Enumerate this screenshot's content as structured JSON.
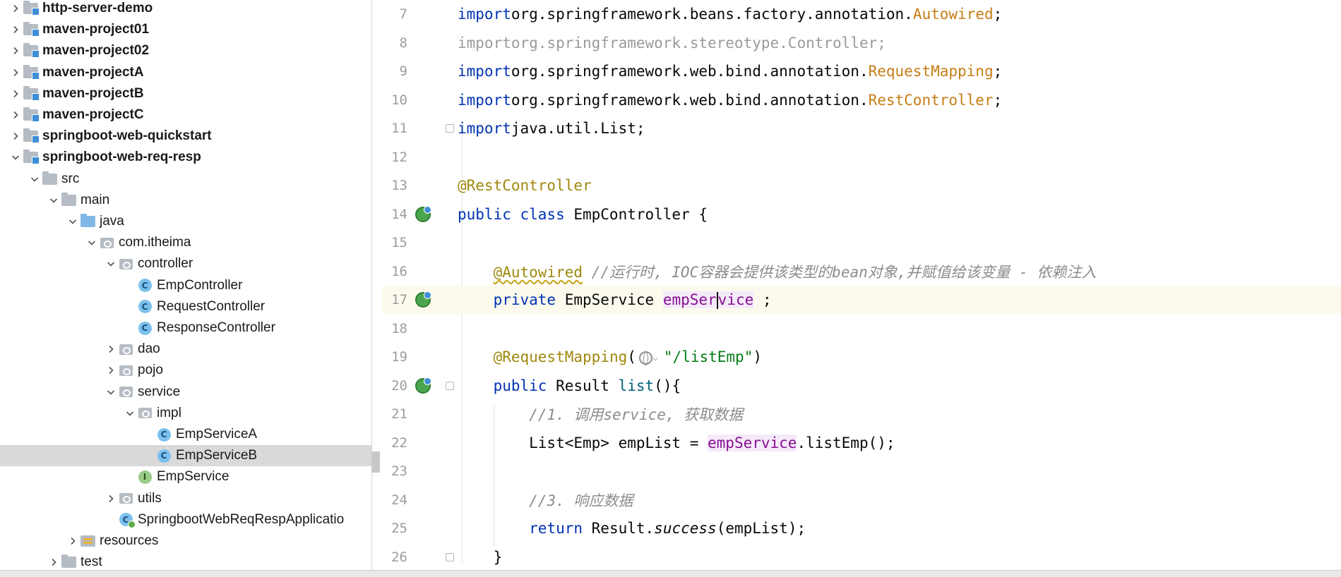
{
  "project_tree": {
    "items": [
      {
        "label": "http-server-demo",
        "depth": 0,
        "kind": "module",
        "expanded": false,
        "bold": true
      },
      {
        "label": "maven-project01",
        "depth": 0,
        "kind": "module",
        "expanded": false,
        "bold": true
      },
      {
        "label": "maven-project02",
        "depth": 0,
        "kind": "module",
        "expanded": false,
        "bold": true
      },
      {
        "label": "maven-projectA",
        "depth": 0,
        "kind": "module",
        "expanded": false,
        "bold": true
      },
      {
        "label": "maven-projectB",
        "depth": 0,
        "kind": "module",
        "expanded": false,
        "bold": true
      },
      {
        "label": "maven-projectC",
        "depth": 0,
        "kind": "module",
        "expanded": false,
        "bold": true
      },
      {
        "label": "springboot-web-quickstart",
        "depth": 0,
        "kind": "module",
        "expanded": false,
        "bold": true
      },
      {
        "label": "springboot-web-req-resp",
        "depth": 0,
        "kind": "module",
        "expanded": true,
        "bold": true
      },
      {
        "label": "src",
        "depth": 1,
        "kind": "folder",
        "expanded": true
      },
      {
        "label": "main",
        "depth": 2,
        "kind": "folder",
        "expanded": true
      },
      {
        "label": "java",
        "depth": 3,
        "kind": "source-folder",
        "expanded": true
      },
      {
        "label": "com.itheima",
        "depth": 4,
        "kind": "package",
        "expanded": true
      },
      {
        "label": "controller",
        "depth": 5,
        "kind": "package",
        "expanded": true
      },
      {
        "label": "EmpController",
        "depth": 6,
        "kind": "class"
      },
      {
        "label": "RequestController",
        "depth": 6,
        "kind": "class"
      },
      {
        "label": "ResponseController",
        "depth": 6,
        "kind": "class"
      },
      {
        "label": "dao",
        "depth": 5,
        "kind": "package",
        "expanded": false
      },
      {
        "label": "pojo",
        "depth": 5,
        "kind": "package",
        "expanded": false
      },
      {
        "label": "service",
        "depth": 5,
        "kind": "package",
        "expanded": true
      },
      {
        "label": "impl",
        "depth": 6,
        "kind": "package",
        "expanded": true
      },
      {
        "label": "EmpServiceA",
        "depth": 7,
        "kind": "class"
      },
      {
        "label": "EmpServiceB",
        "depth": 7,
        "kind": "class",
        "selected": true
      },
      {
        "label": "EmpService",
        "depth": 6,
        "kind": "interface"
      },
      {
        "label": "utils",
        "depth": 5,
        "kind": "package",
        "expanded": false
      },
      {
        "label": "SpringbootWebReqRespApplicatio",
        "depth": 5,
        "kind": "app-class"
      },
      {
        "label": "resources",
        "depth": 3,
        "kind": "resources-folder",
        "expanded": false
      },
      {
        "label": "test",
        "depth": 2,
        "kind": "folder",
        "expanded": false
      }
    ]
  },
  "editor": {
    "lines": [
      {
        "n": "7",
        "tokens": [
          [
            "kw",
            "import"
          ],
          [
            "",
            "org.springframework.beans.factory.annotation."
          ],
          [
            "cls-ref",
            "Autowired"
          ],
          [
            "",
            ";"
          ]
        ]
      },
      {
        "n": "8",
        "faded": true,
        "tokens": [
          [
            "kw",
            "import"
          ],
          [
            "",
            "org.springframework.stereotype.Controller;"
          ]
        ]
      },
      {
        "n": "9",
        "tokens": [
          [
            "kw",
            "import"
          ],
          [
            "",
            "org.springframework.web.bind.annotation."
          ],
          [
            "cls-ref",
            "RequestMapping"
          ],
          [
            "",
            ";"
          ]
        ]
      },
      {
        "n": "10",
        "tokens": [
          [
            "kw",
            "import"
          ],
          [
            "",
            "org.springframework.web.bind.annotation."
          ],
          [
            "cls-ref",
            "RestController"
          ],
          [
            "",
            ";"
          ]
        ]
      },
      {
        "n": "11",
        "fold": true,
        "tokens": [
          [
            "kw",
            "import"
          ],
          [
            "",
            "java.util.List;"
          ]
        ]
      },
      {
        "n": "12",
        "tokens": []
      },
      {
        "n": "13",
        "tokens": [
          [
            "ann",
            "@RestController"
          ]
        ]
      },
      {
        "n": "14",
        "gutter_icon": "spring-bean-icon",
        "tokens": [
          [
            "kw",
            "public class"
          ],
          [
            "",
            " EmpController {"
          ]
        ]
      },
      {
        "n": "15",
        "tokens": []
      },
      {
        "n": "16",
        "tokens": [
          [
            "",
            "    "
          ],
          [
            "ann squig",
            "@Autowired"
          ],
          [
            "",
            " "
          ],
          [
            "cmt",
            "//运行时, IOC容器会提供该类型的bean对象,并赋值给该变量 - 依赖注入"
          ]
        ]
      },
      {
        "n": "17",
        "current": true,
        "gutter_icon": "spring-bean-icon",
        "tokens": [
          [
            "",
            "    "
          ],
          [
            "kw",
            "private"
          ],
          [
            "",
            " EmpService "
          ],
          [
            "field",
            "empSer"
          ],
          [
            "caret",
            ""
          ],
          [
            "field",
            "vice"
          ],
          [
            "",
            " ;"
          ]
        ]
      },
      {
        "n": "18",
        "tokens": []
      },
      {
        "n": "19",
        "tokens": [
          [
            "",
            "    "
          ],
          [
            "ann",
            "@RequestMapping"
          ],
          [
            "",
            "("
          ],
          [
            "globe",
            ""
          ],
          [
            "str",
            "\""
          ],
          [
            "str u",
            "/listEmp"
          ],
          [
            "str",
            "\""
          ],
          [
            "",
            ")"
          ]
        ]
      },
      {
        "n": "20",
        "fold": true,
        "gutter_icon": "spring-bean-icon",
        "tokens": [
          [
            "",
            "    "
          ],
          [
            "kw",
            "public"
          ],
          [
            "",
            " Result "
          ],
          [
            "meth",
            "list"
          ],
          [
            "",
            "(){"
          ]
        ]
      },
      {
        "n": "21",
        "tokens": [
          [
            "",
            "        "
          ],
          [
            "cmt",
            "//1. 调用service, 获取数据"
          ]
        ]
      },
      {
        "n": "22",
        "tokens": [
          [
            "",
            "        List<Emp> empList = "
          ],
          [
            "field",
            "empService"
          ],
          [
            "",
            ".listEmp();"
          ]
        ]
      },
      {
        "n": "23",
        "tokens": []
      },
      {
        "n": "24",
        "tokens": [
          [
            "",
            "        "
          ],
          [
            "cmt",
            "//3. 响应数据"
          ]
        ]
      },
      {
        "n": "25",
        "tokens": [
          [
            "",
            "        "
          ],
          [
            "kw",
            "return"
          ],
          [
            "",
            " Result."
          ],
          [
            "ital",
            "success"
          ],
          [
            "",
            "(empList);"
          ]
        ]
      },
      {
        "n": "26",
        "fold": true,
        "tokens": [
          [
            "",
            "    }"
          ]
        ]
      }
    ]
  },
  "colors": {
    "keyword": "#0033b3",
    "annotation": "#9e880d",
    "class_ref": "#c77d15",
    "comment": "#8c8c8c",
    "field": "#871094",
    "string": "#067d17",
    "current_line": "#fcfaed",
    "selection": "#d9d9d9"
  }
}
